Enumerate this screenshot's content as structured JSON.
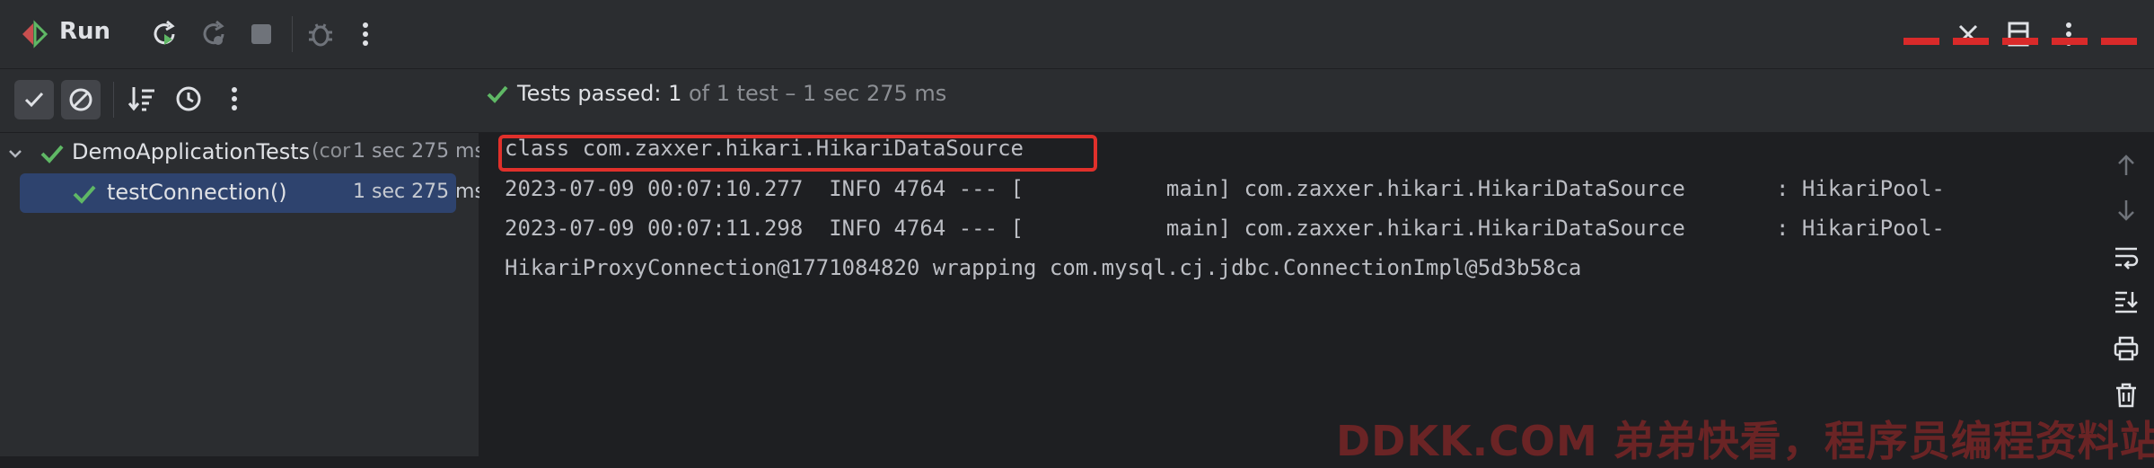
{
  "toolbar": {
    "title": "Run",
    "icons": [
      "run-tool-icon",
      "rerun-icon",
      "rerun-failed-icon",
      "stop-icon",
      "debug-icon",
      "more-icon"
    ],
    "right_icons": [
      "close-icon",
      "more-icon",
      "minimize-icon"
    ]
  },
  "testbar": {
    "status_label": "Tests passed: ",
    "passed_count": "1",
    "status_rest": " of 1 test – 1 sec 275 ms"
  },
  "tree": {
    "root": {
      "label": "DemoApplicationTests",
      "suffix": "(cor",
      "time": "1 sec 275 ms"
    },
    "child": {
      "label": "testConnection()",
      "time": "1 sec 275 ms"
    }
  },
  "console": {
    "lines": [
      "class com.zaxxer.hikari.HikariDataSource",
      "2023-07-09 00:07:10.277  INFO 4764 --- [           main] com.zaxxer.hikari.HikariDataSource       : HikariPool-",
      "2023-07-09 00:07:11.298  INFO 4764 --- [           main] com.zaxxer.hikari.HikariDataSource       : HikariPool-",
      "HikariProxyConnection@1771084820 wrapping com.mysql.cj.jdbc.ConnectionImpl@5d3b58ca"
    ]
  },
  "watermark": "DDKK.COM 弟弟快看，程序员编程资料站",
  "colors": {
    "accent_green": "#5fb865",
    "highlight_red": "#e0302b",
    "selection": "#2e436e"
  }
}
